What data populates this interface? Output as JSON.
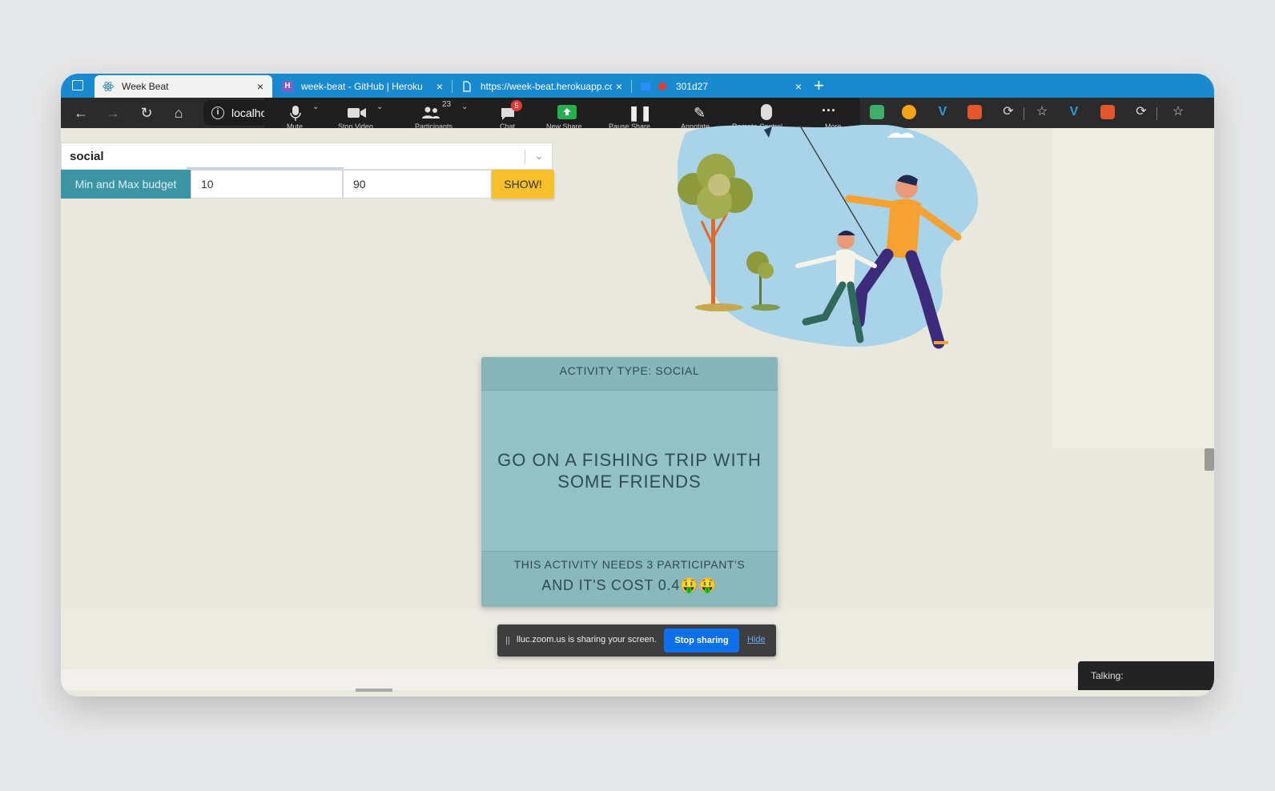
{
  "browser": {
    "tabs": [
      {
        "title": "Week Beat",
        "icon": "react-icon",
        "active": true
      },
      {
        "title": "week-beat - GitHub | Heroku",
        "icon": "heroku-icon",
        "active": false
      },
      {
        "title": "https://week-beat.herokuapp.co",
        "icon": "page-icon",
        "active": false
      },
      {
        "title": "301d27",
        "icon": "zoom-icon",
        "active": false
      }
    ],
    "address": "localho",
    "colors": {
      "tabstrip": "#1a8ad0",
      "toolbar": "#2b2b2b"
    }
  },
  "zoom": {
    "buttons": [
      {
        "label": "Mute"
      },
      {
        "label": "Stop Video"
      },
      {
        "label": "Participants",
        "count": "23"
      },
      {
        "label": "Chat",
        "badge": "5"
      },
      {
        "label": "New Share"
      },
      {
        "label": "Pause Share"
      },
      {
        "label": "Annotate"
      },
      {
        "label": "Remote Control"
      },
      {
        "label": "More"
      }
    ]
  },
  "form": {
    "activity_select": "social",
    "budget_label": "Min and Max budget",
    "min_budget": "10",
    "max_budget": "90",
    "show_button": "SHOW!"
  },
  "card": {
    "type": "ACTIVITY TYPE: SOCIAL",
    "activity": "GO ON A FISHING TRIP WITH SOME FRIENDS",
    "participants": "THIS ACTIVITY NEEDS 3 PARTICIPANT'S",
    "cost": "AND IT'S COST 0.4🤑🤑"
  },
  "share_bar": {
    "message": "lluc.zoom.us is sharing your screen.",
    "stop": "Stop sharing",
    "hide": "Hide"
  },
  "talking": "Talking:",
  "colors": {
    "accent_yellow": "#f6c02c",
    "budget_teal": "#3d95a4",
    "card_teal": "#92c2c6",
    "stop_blue": "#0e71eb"
  }
}
